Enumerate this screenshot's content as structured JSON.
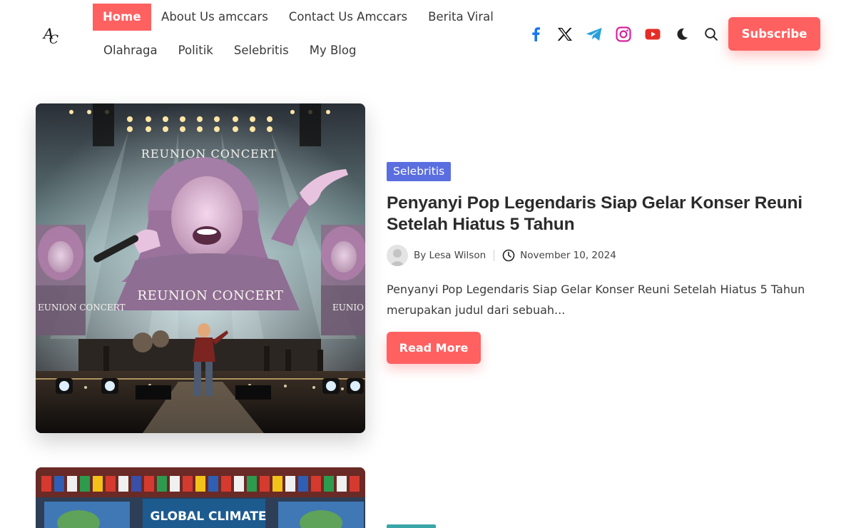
{
  "site": {
    "logo_text": "AC"
  },
  "nav": {
    "row1": [
      "Home",
      "About Us amccars",
      "Contact Us Amccars",
      "Berita Viral"
    ],
    "row2": [
      "Olahraga",
      "Politik",
      "Selebritis",
      "My Blog"
    ],
    "active": "Home"
  },
  "social": {
    "icons": [
      "facebook-icon",
      "x-icon",
      "telegram-icon",
      "instagram-icon",
      "youtube-icon",
      "dark-mode-icon",
      "search-icon"
    ],
    "colors": {
      "facebook": "#1877f2",
      "x": "#111111",
      "telegram": "#2aa0da",
      "instagram": "#d6249f",
      "youtube": "#e52d27"
    }
  },
  "header": {
    "subscribe_label": "Subscribe"
  },
  "post": {
    "category": "Selebritis",
    "title": "Penyanyi Pop Legendaris Siap Gelar Konser Reuni Setelah Hiatus 5 Tahun",
    "author": "By Lesa Wilson",
    "date": "November 10, 2024",
    "excerpt": "Penyanyi Pop Legendaris Siap Gelar Konser Reuni Setelah Hiatus 5 Tahun merupakan judul dari sebuah...",
    "read_more": "Read More",
    "image_text_top": "REUNION CONCERT",
    "image_text_mid": "REUNION CONCERT",
    "image_text_left": "EUNION CONCERT",
    "image_text_right": "EUNIO CONC"
  },
  "next_post": {
    "image_text": "GLOBAL CLIMATE"
  },
  "colors": {
    "accent": "#ff6161",
    "category": "#5a6ee0"
  }
}
